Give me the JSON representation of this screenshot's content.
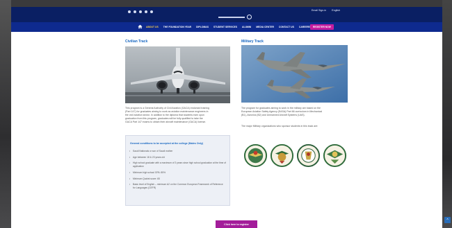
{
  "header": {
    "social_icons": [
      "twitter-icon",
      "facebook-icon",
      "instagram-icon",
      "youtube-icon",
      "linkedin-icon"
    ],
    "login_label": "Email Sign-in",
    "language_label": "English"
  },
  "nav": {
    "items": [
      "ABOUT US",
      "THE FOUNDATION YEAR",
      "DIPLOMAS",
      "STUDENT SERVICES",
      "ALUMNI",
      "MEDIA CENTER",
      "CONTACT US",
      "CAREERS"
    ],
    "register_label": "REGISTER NOW"
  },
  "civilian": {
    "title": "Civilian Track",
    "paragraph_lines": [
      "This program is a General Authority of Civil Aviation (GACA) endorsed training",
      "(Part 147) for graduates aiming to work as aviation maintenance engineers in",
      "the civil aviation sector. In addition to the diploma that students earn upon",
      "graduation from this program, graduates will be fully qualified to take the",
      "GACA Part 147 exams to obtain their aircraft maintenance (GACA) license."
    ]
  },
  "military": {
    "title": "Military Track",
    "paragraph_lines": [
      "The program for graduates aiming to work in the military are based on the",
      "European Aviation Safety Agency (EASA) Part 66 curriculum in Mechanical",
      "(B1), Avionics (B2) and Unmanned Aircraft Systems (UAS)."
    ],
    "orgs_line": "The major Military organizations who sponsor students in this track are:"
  },
  "conditions": {
    "title": "General conditions to be accepted at the college (Males Only)",
    "items": [
      "Saudi Nationals or son of Saudi mother",
      "Age between 18 & 23 years old",
      "High school graduate with a maximum of 3 years since high school graduation at the time of application",
      "Minimum high school GPA: 85%",
      "Minimum Qudrat score: 65",
      "Basic level of English – minimum A2 on the Common European Framework of Reference for Languages (CEFR)"
    ]
  },
  "footer": {
    "apply_label": "Click here to register"
  },
  "colors": {
    "topbar": "#0a1f63",
    "navbar": "#0e2a8e",
    "accent_blue": "#1565c0",
    "register_magenta": "#c51c9f"
  }
}
